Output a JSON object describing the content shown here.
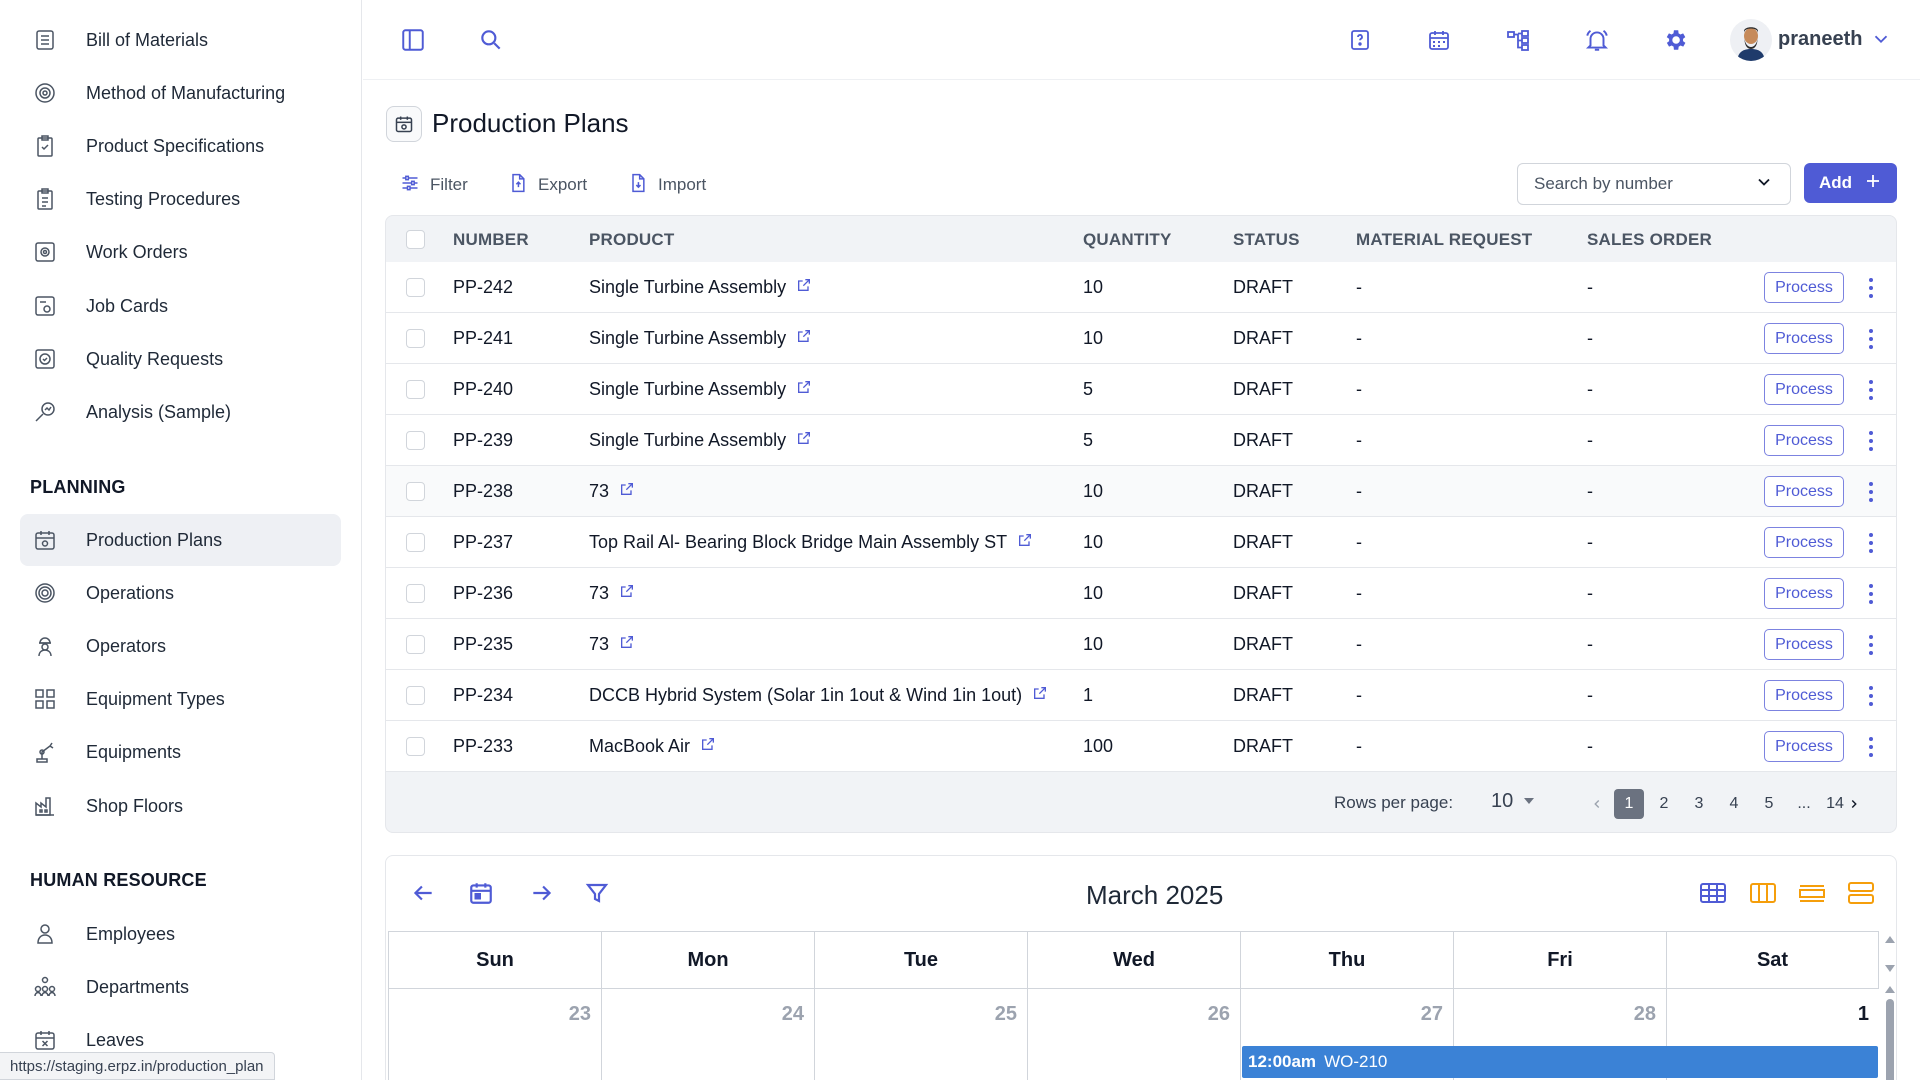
{
  "sidebar": {
    "items_top": [
      {
        "label": "Bill of Materials",
        "icon": "list-icon"
      },
      {
        "label": "Method of Manufacturing",
        "icon": "gear-circle-icon"
      },
      {
        "label": "Product Specifications",
        "icon": "clipboard-check-icon"
      },
      {
        "label": "Testing Procedures",
        "icon": "clipboard-list-icon"
      },
      {
        "label": "Work Orders",
        "icon": "cog-square-icon"
      },
      {
        "label": "Job Cards",
        "icon": "card-icon"
      },
      {
        "label": "Quality Requests",
        "icon": "quality-icon"
      },
      {
        "label": "Analysis (Sample)",
        "icon": "analysis-icon"
      }
    ],
    "planning_heading": "PLANNING",
    "planning_items": [
      {
        "label": "Production Plans",
        "icon": "calendar-gear-icon",
        "active": true
      },
      {
        "label": "Operations",
        "icon": "target-gear-icon"
      },
      {
        "label": "Operators",
        "icon": "worker-icon"
      },
      {
        "label": "Equipment Types",
        "icon": "grid-icon"
      },
      {
        "label": "Equipments",
        "icon": "robot-arm-icon"
      },
      {
        "label": "Shop Floors",
        "icon": "factory-icon"
      }
    ],
    "hr_heading": "HUMAN RESOURCE",
    "hr_items": [
      {
        "label": "Employees",
        "icon": "person-icon"
      },
      {
        "label": "Departments",
        "icon": "org-icon"
      },
      {
        "label": "Leaves",
        "icon": "calendar-x-icon"
      }
    ],
    "status_url": "https://staging.erpz.in/production_plan"
  },
  "topbar": {
    "username": "praneeth",
    "icons": [
      "sidebar-toggle-icon",
      "search-icon",
      "help-icon",
      "calendar-icon",
      "hierarchy-icon",
      "bell-icon",
      "settings-icon"
    ]
  },
  "page": {
    "title": "Production Plans",
    "filter_label": "Filter",
    "export_label": "Export",
    "import_label": "Import",
    "search_placeholder": "Search by number",
    "add_label": "Add"
  },
  "table": {
    "columns": [
      "NUMBER",
      "PRODUCT",
      "QUANTITY",
      "STATUS",
      "MATERIAL REQUEST",
      "SALES ORDER"
    ],
    "action_label": "Process",
    "rows": [
      {
        "number": "PP-242",
        "product": "Single Turbine Assembly",
        "quantity": "10",
        "status": "DRAFT",
        "material_request": "-",
        "sales_order": "-"
      },
      {
        "number": "PP-241",
        "product": "Single Turbine Assembly",
        "quantity": "10",
        "status": "DRAFT",
        "material_request": "-",
        "sales_order": "-"
      },
      {
        "number": "PP-240",
        "product": "Single Turbine Assembly",
        "quantity": "5",
        "status": "DRAFT",
        "material_request": "-",
        "sales_order": "-"
      },
      {
        "number": "PP-239",
        "product": "Single Turbine Assembly",
        "quantity": "5",
        "status": "DRAFT",
        "material_request": "-",
        "sales_order": "-"
      },
      {
        "number": "PP-238",
        "product": "73",
        "quantity": "10",
        "status": "DRAFT",
        "material_request": "-",
        "sales_order": "-"
      },
      {
        "number": "PP-237",
        "product": "Top Rail Al- Bearing Block Bridge Main Assembly ST",
        "quantity": "10",
        "status": "DRAFT",
        "material_request": "-",
        "sales_order": "-"
      },
      {
        "number": "PP-236",
        "product": "73",
        "quantity": "10",
        "status": "DRAFT",
        "material_request": "-",
        "sales_order": "-"
      },
      {
        "number": "PP-235",
        "product": "73",
        "quantity": "10",
        "status": "DRAFT",
        "material_request": "-",
        "sales_order": "-"
      },
      {
        "number": "PP-234",
        "product": "DCCB Hybrid System (Solar 1in 1out & Wind 1in 1out)",
        "quantity": "1",
        "status": "DRAFT",
        "material_request": "-",
        "sales_order": "-"
      },
      {
        "number": "PP-233",
        "product": "MacBook Air",
        "quantity": "100",
        "status": "DRAFT",
        "material_request": "-",
        "sales_order": "-"
      }
    ],
    "rows_per_page_label": "Rows per page:",
    "rows_per_page": "10",
    "pages": [
      "1",
      "2",
      "3",
      "4",
      "5",
      "...",
      "14"
    ],
    "current_page": "1"
  },
  "calendar": {
    "title": "March 2025",
    "weekdays": [
      "Sun",
      "Mon",
      "Tue",
      "Wed",
      "Thu",
      "Fri",
      "Sat"
    ],
    "first_row_days": [
      "23",
      "24",
      "25",
      "26",
      "27",
      "28",
      "1"
    ],
    "event_time": "12:00am",
    "event_label": "WO-210",
    "colors": {
      "event": "#3b82d6",
      "accent": "#4f5bd5",
      "view_orange": "#f59e0b"
    }
  }
}
